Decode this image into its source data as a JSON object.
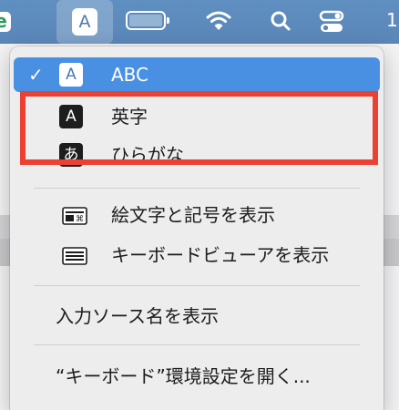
{
  "menubar": {
    "app_logo_letter": "e",
    "input_source_glyph": "A",
    "clock_fragment": "1",
    "icons": [
      "battery-icon",
      "wifi-icon",
      "search-icon",
      "control-center-icon"
    ]
  },
  "menu": {
    "sources": [
      {
        "icon": "A",
        "label": "ABC",
        "selected": true
      },
      {
        "icon": "A",
        "label": "英字",
        "selected": false
      },
      {
        "icon": "あ",
        "label": "ひらがな",
        "selected": false
      }
    ],
    "check_mark": "✓",
    "show_emoji": "絵文字と記号を表示",
    "show_keyboard_viewer": "キーボードビューアを表示",
    "show_input_source_name": "入力ソース名を表示",
    "open_keyboard_prefs": "“キーボード”環境設定を開く..."
  },
  "colors": {
    "menubar": "#5a86b8",
    "selection": "#4a90e2",
    "annotation": "#ea4132"
  }
}
